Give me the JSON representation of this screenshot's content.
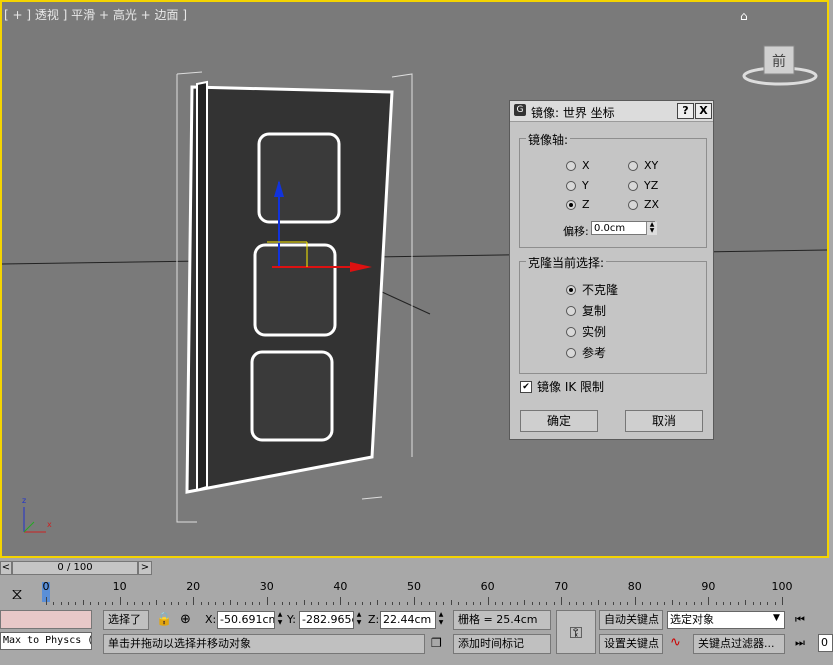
{
  "viewport": {
    "label": "[ + ] 透视 ] 平滑 + 高光 + 边面 ]",
    "home_icon": "home-icon",
    "viewcube_label": "前",
    "axis_labels": [
      "z",
      "x"
    ]
  },
  "dialog": {
    "title": "镜像: 世界 坐标",
    "help_label": "?",
    "close_label": "X",
    "mirror_axis": {
      "label": "镜像轴:",
      "options": [
        "X",
        "Y",
        "Z",
        "XY",
        "YZ",
        "ZX"
      ],
      "selected": "Z",
      "offset_label": "偏移:",
      "offset_value": "0.0cm"
    },
    "clone": {
      "label": "克隆当前选择:",
      "options": [
        "不克隆",
        "复制",
        "实例",
        "参考"
      ],
      "selected": "不克隆"
    },
    "mirror_ik_label": "镜像 IK 限制",
    "mirror_ik_checked": true,
    "ok_label": "确定",
    "cancel_label": "取消"
  },
  "timeline": {
    "slider_text": "0 / 100",
    "left_arrow": "<",
    "right_arrow": ">",
    "ticks": [
      "0",
      "10",
      "20",
      "30",
      "40",
      "50",
      "60",
      "70",
      "80",
      "90",
      "100"
    ]
  },
  "status": {
    "script_label": "Max to Physcs (",
    "selected_label": "选择了",
    "x_label": "X:",
    "x_value": "-50.691cm",
    "y_label": "Y:",
    "y_value": "-282.965cm",
    "z_label": "Z:",
    "z_value": "22.44cm",
    "grid_label": "栅格 = 25.4cm",
    "prompt": "单击并拖动以选择并移动对象",
    "add_time_tag": "添加时间标记",
    "auto_key": "自动关键点",
    "set_key": "设置关键点",
    "selection_dropdown": "选定对象",
    "key_filters": "关键点过滤器...",
    "frame_value": "0"
  }
}
